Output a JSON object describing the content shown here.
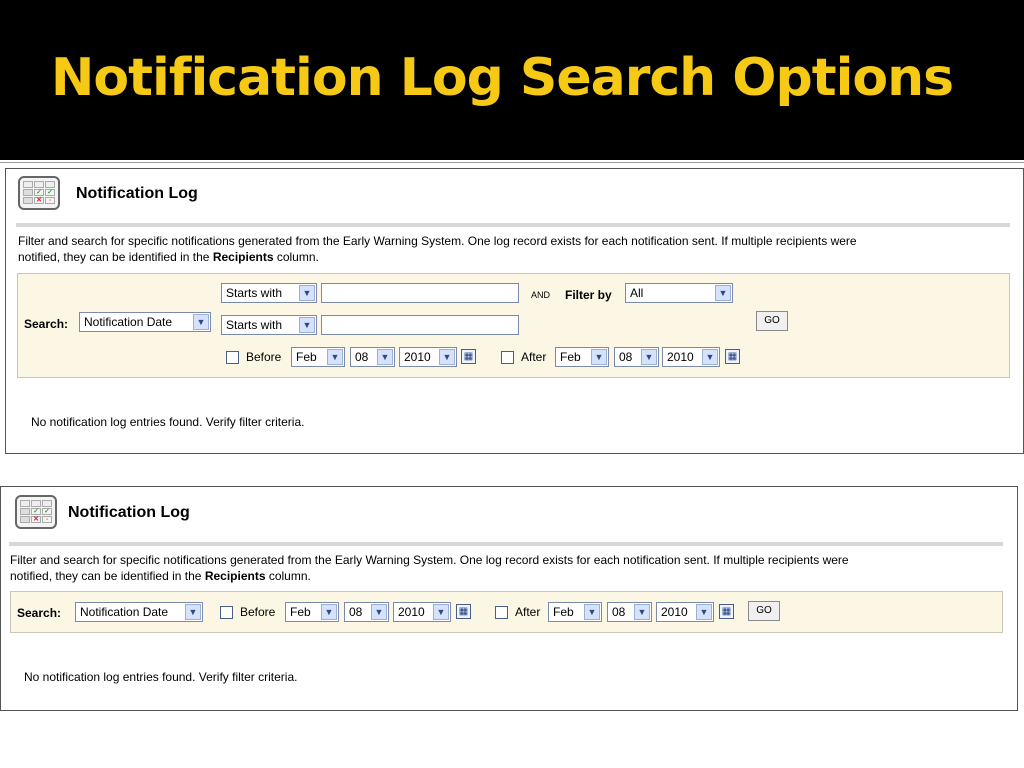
{
  "slide": {
    "title": "Notification Log Search Options"
  },
  "panel1": {
    "title": "Notification Log",
    "desc_1": "Filter and search for specific notifications generated from the Early Warning System. One log record exists for each notification sent. If multiple recipients were",
    "desc_2a": "notified, they can be identified in the ",
    "desc_2b": "Recipients",
    "desc_2c": " column.",
    "search_label": "Search:",
    "search_field": "Notification Date",
    "match_1": "Starts with",
    "match_2": "Starts with",
    "and_label": "AND",
    "filter_by_label": "Filter by",
    "filter_by_value": "All",
    "go_label": "GO",
    "before_label": "Before",
    "after_label": "After",
    "before_month": "Feb",
    "before_day": "08",
    "before_year": "2010",
    "after_month": "Feb",
    "after_day": "08",
    "after_year": "2010",
    "message": "No notification log entries found. Verify filter criteria."
  },
  "panel2": {
    "title": "Notification Log",
    "desc_1": "Filter and search for specific notifications generated from the Early Warning System. One log record exists for each notification sent. If multiple recipients were",
    "desc_2a": "notified, they can be identified in the ",
    "desc_2b": "Recipients",
    "desc_2c": " column.",
    "search_label": "Search:",
    "search_field": "Notification Date",
    "go_label": "GO",
    "before_label": "Before",
    "after_label": "After",
    "before_month": "Feb",
    "before_day": "08",
    "before_year": "2010",
    "after_month": "Feb",
    "after_day": "08",
    "after_year": "2010",
    "message": "No notification log entries found. Verify filter criteria."
  },
  "icons": {
    "dropdown_arrow": "chevron-down-icon",
    "calendar": "calendar-icon",
    "log": "log-grid-icon"
  }
}
